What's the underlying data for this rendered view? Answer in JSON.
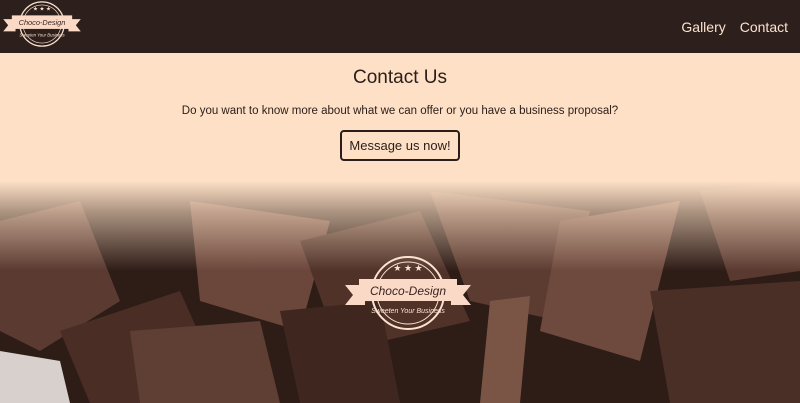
{
  "nav": {
    "brand": "Choco-Design",
    "tagline": "Sweeten Your Business",
    "links": [
      "Gallery",
      "Contact"
    ]
  },
  "contact": {
    "title": "Contact Us",
    "text": "Do you want to know more about what we can offer or you have a business proposal?",
    "button": "Message us now!"
  },
  "colors": {
    "header": "#2d1f1b",
    "section": "#fde0c6",
    "logo_ribbon": "#fbd9c7"
  }
}
